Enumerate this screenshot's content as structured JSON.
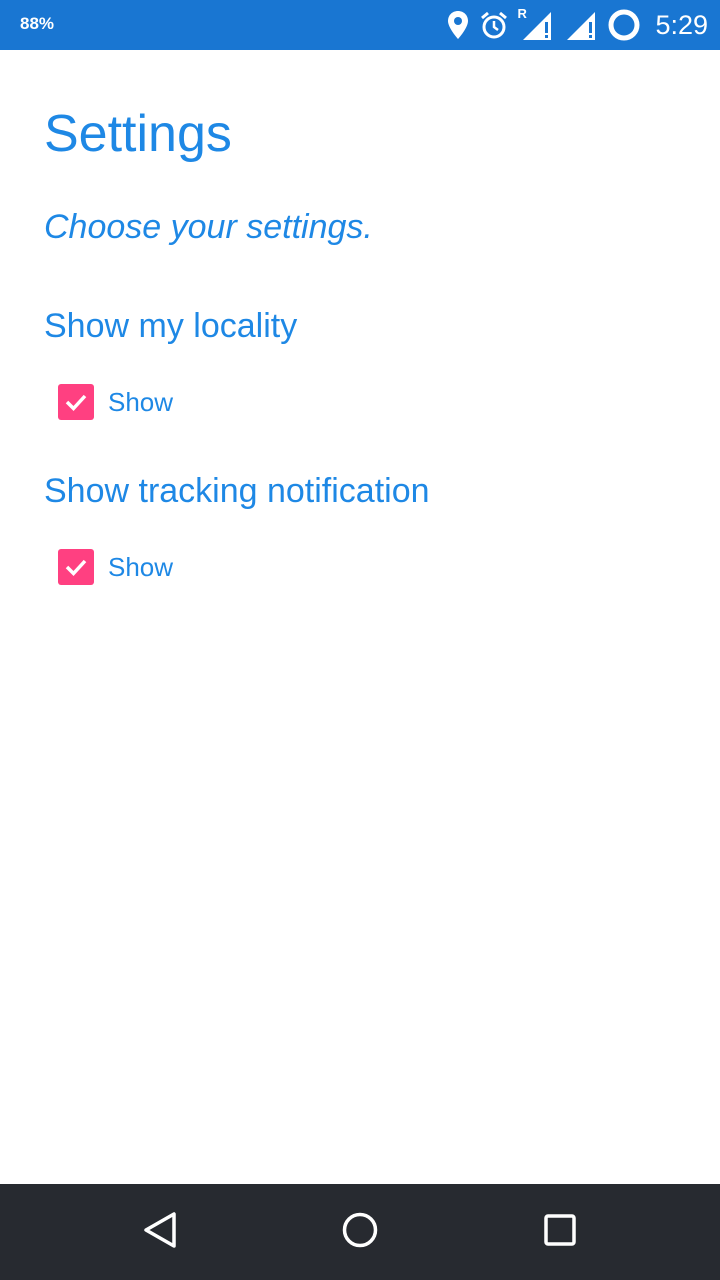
{
  "status_bar": {
    "battery_percent": "88%",
    "time": "5:29",
    "roaming_indicator": "R",
    "icons": [
      "location-icon",
      "alarm-icon",
      "signal-roaming-icon",
      "signal-icon",
      "battery-ring-icon"
    ]
  },
  "page": {
    "title": "Settings",
    "subtitle": "Choose your settings."
  },
  "sections": [
    {
      "heading": "Show my locality",
      "checkbox_label": "Show",
      "checked": true
    },
    {
      "heading": "Show tracking notification",
      "checkbox_label": "Show",
      "checked": true
    }
  ],
  "nav_bar": {
    "icons": [
      "back-icon",
      "home-icon",
      "recents-icon"
    ]
  },
  "colors": {
    "status_bar": "#1976d2",
    "accent_text": "#1e88e5",
    "checkbox": "#ff4081",
    "nav_bar": "#272a30"
  }
}
